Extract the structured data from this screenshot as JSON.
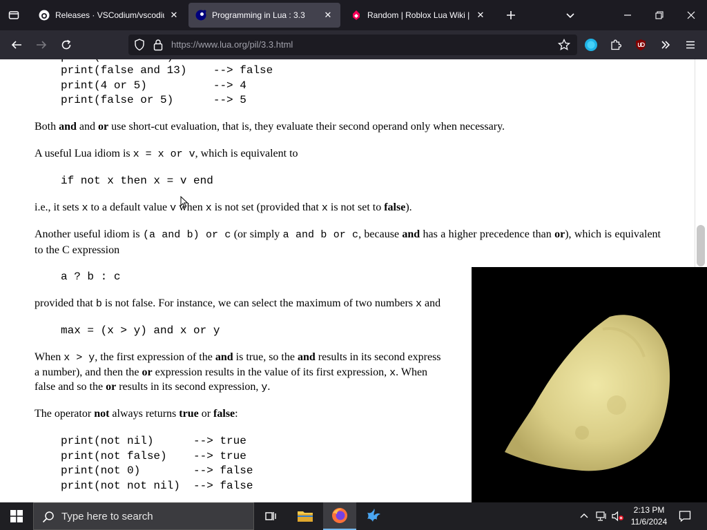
{
  "browser": {
    "tabs": [
      {
        "title": "Releases · VSCodium/vscodium",
        "icon": "github-icon",
        "active": false
      },
      {
        "title": "Programming in Lua : 3.3",
        "icon": "lua-icon",
        "active": true
      },
      {
        "title": "Random | Roblox Lua Wiki | Far",
        "icon": "fandom-icon",
        "active": false
      }
    ],
    "url_host": "https://www.lua.org",
    "url_path": "/pil/3.3.html"
  },
  "page": {
    "code1": [
      "print(false and 13)    --> false",
      "print(4 or 5)          --> 4",
      "print(false or 5)      --> 5"
    ],
    "p1": {
      "a": "Both ",
      "b": "and",
      "c": " and ",
      "d": "or",
      "e": " use short-cut evaluation, that is, they evaluate their second operand only when necessary."
    },
    "p2": {
      "a": "A useful Lua idiom is ",
      "code": "x = x or v",
      "b": ", which is equivalent to"
    },
    "code2": "if not x then x = v end",
    "p3": {
      "a": "i.e., it sets ",
      "x1": "x",
      "b": " to a default value ",
      "v": "v",
      "c": " when ",
      "x2": "x",
      "d": " is not set (provided that ",
      "x3": "x",
      "e": " is not set to ",
      "f": "false",
      "g": ")."
    },
    "p4": {
      "a": "Another useful idiom is ",
      "c1": "(a and b) or c",
      "b": " (or simply ",
      "c2": "a and b or c",
      "c": ", because ",
      "d": "and",
      "e": " has a higher precedence than ",
      "f": "or",
      "g": "), which is equivalent to the C expression"
    },
    "code3": "a ? b : c",
    "p5": {
      "a": "provided that ",
      "b_code": "b",
      "b": " is not false. For instance, we can select the maximum of two numbers ",
      "x": "x",
      "c": " and"
    },
    "code4": "max = (x > y) and x or y",
    "p6": {
      "a": "When ",
      "cond": "x > y",
      "b": ", the first expression of the ",
      "c": "and",
      "d": " is true, so the ",
      "e": "and",
      "f": " results in its second express",
      "g": "a number), and then the ",
      "h": "or",
      "i": " expression results in the value of its first expression, ",
      "x": "x",
      "j": ". When",
      "k": "false and so the ",
      "l": "or",
      "m": " results in its second expression, ",
      "y": "y",
      "n": "."
    },
    "p7": {
      "a": "The operator ",
      "b": "not",
      "c": " always returns ",
      "d": "true",
      "e": " or ",
      "f": "false",
      "g": ":"
    },
    "code5": [
      "print(not nil)      --> true",
      "print(not false)    --> true",
      "print(not 0)        --> false",
      "print(not not nil)  --> false"
    ]
  },
  "taskbar": {
    "search_placeholder": "Type here to search",
    "time": "2:13 PM",
    "date": "11/6/2024"
  },
  "colors": {
    "accent": "#76b9ed",
    "chip": "#e8dc90"
  }
}
